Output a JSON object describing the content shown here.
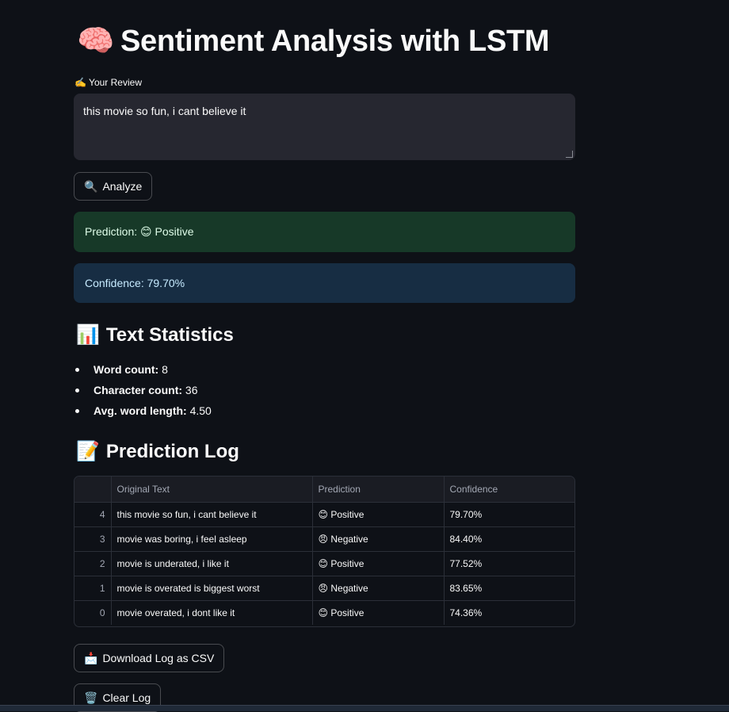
{
  "page": {
    "title": "Sentiment Analysis with LSTM",
    "title_icon": "🧠"
  },
  "input": {
    "label": "✍️ Your Review",
    "value": "this movie so fun, i cant believe it"
  },
  "buttons": {
    "analyze": {
      "icon": "🔍",
      "label": "Analyze"
    },
    "download": {
      "icon": "📩",
      "label": "Download Log as CSV"
    },
    "clear": {
      "icon": "🗑️",
      "label": "Clear Log"
    }
  },
  "result": {
    "prediction_text": "Prediction: 😊 Positive",
    "confidence_text": "Confidence: 79.70%"
  },
  "stats": {
    "heading": "Text Statistics",
    "heading_icon": "📊",
    "items": [
      {
        "label": "Word count:",
        "value": "8"
      },
      {
        "label": "Character count:",
        "value": "36"
      },
      {
        "label": "Avg. word length:",
        "value": "4.50"
      }
    ]
  },
  "log": {
    "heading": "Prediction Log",
    "heading_icon": "📝",
    "columns": [
      "",
      "Original Text",
      "Prediction",
      "Confidence"
    ],
    "rows": [
      {
        "index": "4",
        "text": "this movie so fun, i cant believe it",
        "icon": "😊",
        "prediction": "Positive",
        "confidence": "79.70%"
      },
      {
        "index": "3",
        "text": "movie was boring, i feel asleep",
        "icon": "😠",
        "prediction": "Negative",
        "confidence": "84.40%"
      },
      {
        "index": "2",
        "text": "movie is underated, i like it",
        "icon": "😊",
        "prediction": "Positive",
        "confidence": "77.52%"
      },
      {
        "index": "1",
        "text": "movie is overated is biggest worst",
        "icon": "😠",
        "prediction": "Negative",
        "confidence": "83.65%"
      },
      {
        "index": "0",
        "text": "movie overated, i dont like it",
        "icon": "😊",
        "prediction": "Positive",
        "confidence": "74.36%"
      }
    ]
  },
  "colors": {
    "background": "#0e1117",
    "input_bg": "#262730",
    "success_bg": "#173928",
    "info_bg": "#172d43"
  }
}
